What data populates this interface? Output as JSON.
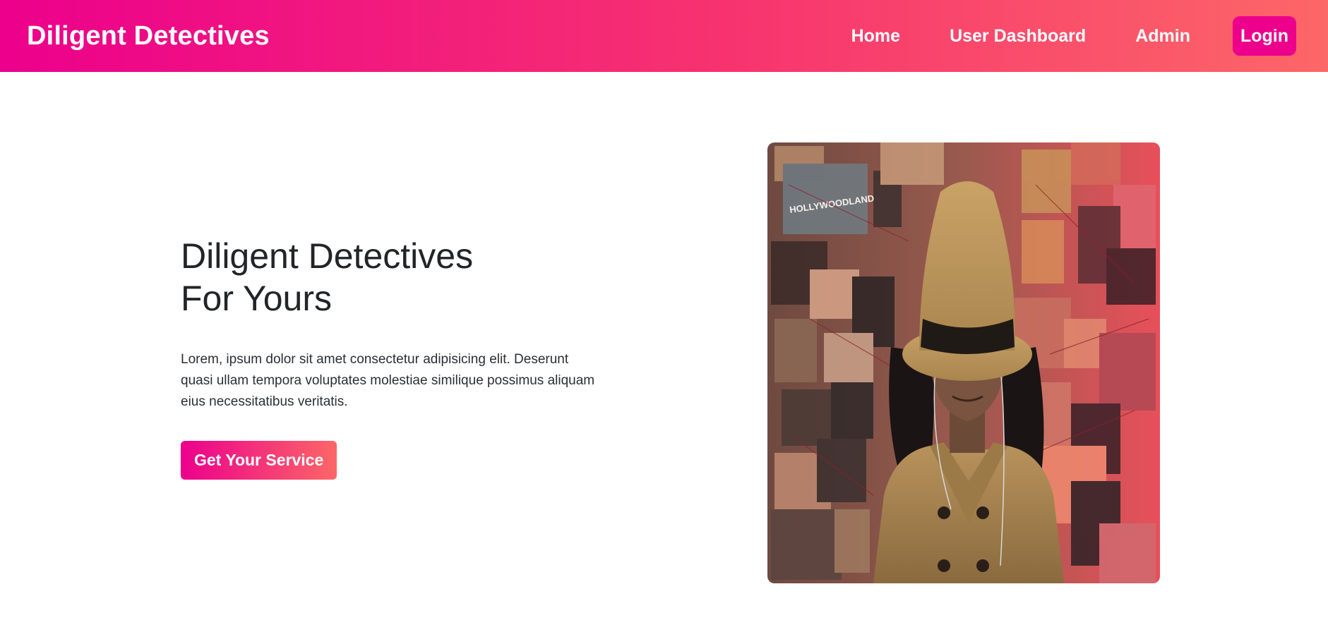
{
  "navbar": {
    "brand": "Diligent Detectives",
    "links": [
      "Home",
      "User Dashboard",
      "Admin"
    ],
    "login_label": "Login"
  },
  "hero": {
    "title_line1": "Diligent Detectives",
    "title_line2": "For Yours",
    "description": "Lorem, ipsum dolor sit amet consectetur adipisicing elit. Deserunt quasi ullam tempora voluptates molestiae similique possimus aliquam eius necessitatibus veritatis.",
    "cta_label": "Get Your Service",
    "image_sign_text": "HOLLYWOODLAND"
  },
  "colors": {
    "gradient_start": "#ec008c",
    "gradient_end": "#fc6767",
    "text_dark": "#212529"
  }
}
